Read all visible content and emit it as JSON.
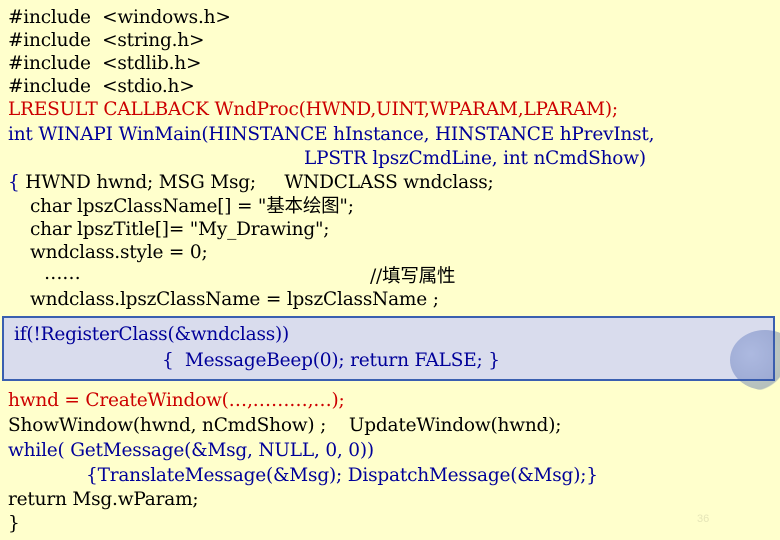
{
  "code": {
    "l1": "#include  <windows.h>",
    "l2": "#include  <string.h>",
    "l3": "#include  <stdlib.h>",
    "l4": "#include  <stdio.h>",
    "l5": "LRESULT CALLBACK WndProc(HWND,UINT,WPARAM,LPARAM);",
    "l6": "int WINAPI WinMain(HINSTANCE hInstance, HINSTANCE hPrevInst,",
    "l7": "LPSTR lpszCmdLine, int nCmdShow)",
    "l8a": "{ ",
    "l8b": "HWND hwnd; MSG Msg;     WNDCLASS wndclass;",
    "l9": "char lpszClassName[] = \"基本绘图\";",
    "l10": "char lpszTitle[]= \"My_Drawing\";",
    "l11": "wndclass.style = 0;",
    "l12": "……",
    "l13": "//填写属性",
    "l14": "wndclass.lpszClassName = lpszClassName ;",
    "l15": "if(!RegisterClass(&wndclass))",
    "l16": "{  MessageBeep(0); return FALSE; }",
    "l17": "hwnd = CreateWindow(…,………,…);",
    "l18": "ShowWindow(hwnd, nCmdShow) ;    UpdateWindow(hwnd);",
    "l19": "while( GetMessage(&Msg, NULL, 0, 0))",
    "l20": "{TranslateMessage(&Msg); DispatchMessage(&Msg);}",
    "l21": "return Msg.wParam;",
    "l22": "}"
  },
  "page_number": "36",
  "colors": {
    "background": "#ffffcc",
    "highlight": "#d9dced",
    "highlight_border": "#3a5fb0",
    "red": "#cc0000",
    "blue": "#000099"
  }
}
